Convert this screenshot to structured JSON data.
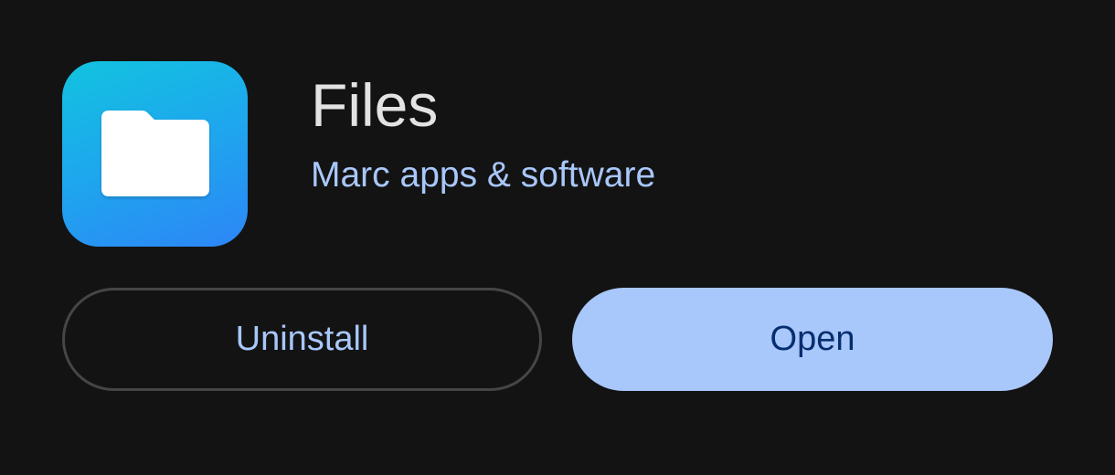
{
  "app": {
    "name": "Files",
    "developer": "Marc apps & software",
    "icon": "folder-icon",
    "icon_colors": [
      "#12c3df",
      "#2d86f6"
    ]
  },
  "actions": {
    "uninstall_label": "Uninstall",
    "open_label": "Open"
  },
  "colors": {
    "background": "#131313",
    "accent": "#a8c7fa",
    "title": "#e3e3e3",
    "open_text": "#062e6f",
    "outline": "#444746"
  }
}
